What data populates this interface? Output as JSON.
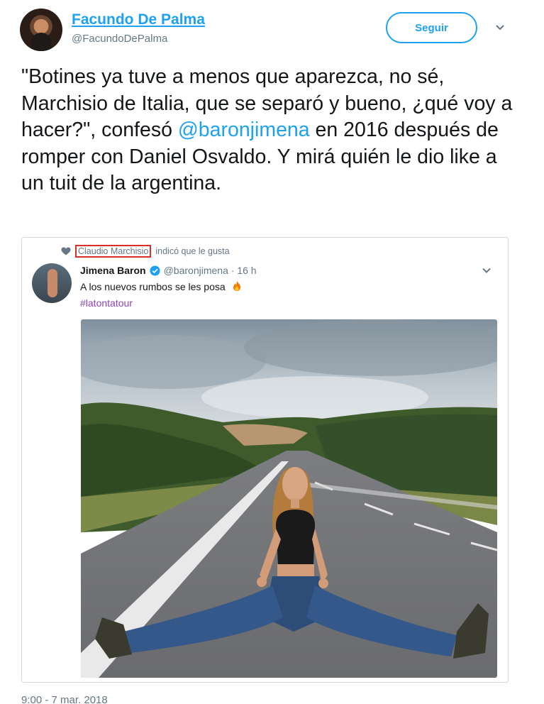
{
  "author": {
    "name": "Facundo De Palma",
    "handle": "@FacundoDePalma",
    "follow_label": "Seguir"
  },
  "tweet": {
    "text_before": "\"Botines ya tuve a menos que aparezca, no sé, Marchisio de Italia, que se separó y bueno, ¿qué voy a hacer?\", confesó ",
    "mention": "@baronjimena",
    "text_after": " en 2016 después de romper con Daniel Osvaldo. Y mirá quién le dio like a un tuit de la argentina.",
    "timestamp": "9:00 - 7 mar. 2018"
  },
  "embedded": {
    "liked_by_name": "Claudio Marchisio",
    "liked_suffix": "indicó que le gusta",
    "name": "Jimena Baron",
    "handle_time": "@baronjimena · 16 h",
    "text": "A los nuevos rumbos se les posa",
    "hashtag": "#latontatour"
  },
  "icons": {
    "follow_menu": "chevron-down-icon",
    "liked": "heart-icon",
    "verified": "verified-badge-icon",
    "embed_menu": "chevron-down-icon",
    "emoji": "fire-emoji-icon"
  },
  "colors": {
    "accent": "#1da1f2",
    "hashtag": "#8e44ad",
    "highlight_box": "#d93025",
    "muted": "#657786"
  }
}
